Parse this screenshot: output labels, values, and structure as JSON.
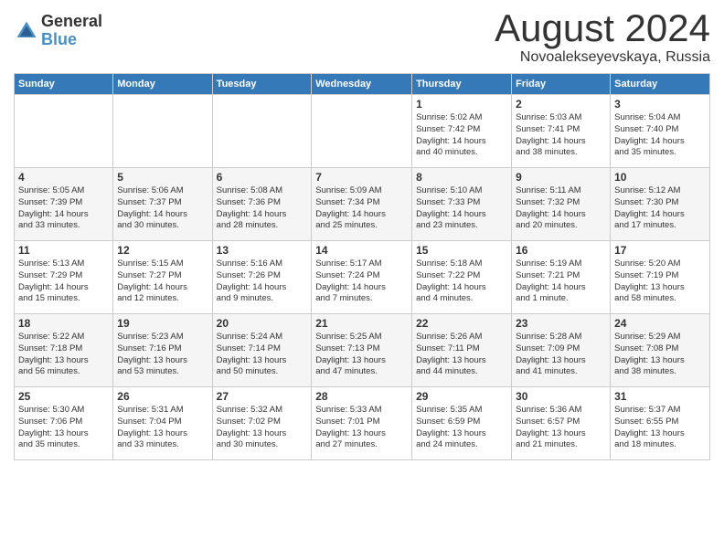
{
  "header": {
    "logo_general": "General",
    "logo_blue": "Blue",
    "month_title": "August 2024",
    "location": "Novoalekseyevskaya, Russia"
  },
  "weekdays": [
    "Sunday",
    "Monday",
    "Tuesday",
    "Wednesday",
    "Thursday",
    "Friday",
    "Saturday"
  ],
  "weeks": [
    [
      {
        "day": "",
        "info": ""
      },
      {
        "day": "",
        "info": ""
      },
      {
        "day": "",
        "info": ""
      },
      {
        "day": "",
        "info": ""
      },
      {
        "day": "1",
        "info": "Sunrise: 5:02 AM\nSunset: 7:42 PM\nDaylight: 14 hours\nand 40 minutes."
      },
      {
        "day": "2",
        "info": "Sunrise: 5:03 AM\nSunset: 7:41 PM\nDaylight: 14 hours\nand 38 minutes."
      },
      {
        "day": "3",
        "info": "Sunrise: 5:04 AM\nSunset: 7:40 PM\nDaylight: 14 hours\nand 35 minutes."
      }
    ],
    [
      {
        "day": "4",
        "info": "Sunrise: 5:05 AM\nSunset: 7:39 PM\nDaylight: 14 hours\nand 33 minutes."
      },
      {
        "day": "5",
        "info": "Sunrise: 5:06 AM\nSunset: 7:37 PM\nDaylight: 14 hours\nand 30 minutes."
      },
      {
        "day": "6",
        "info": "Sunrise: 5:08 AM\nSunset: 7:36 PM\nDaylight: 14 hours\nand 28 minutes."
      },
      {
        "day": "7",
        "info": "Sunrise: 5:09 AM\nSunset: 7:34 PM\nDaylight: 14 hours\nand 25 minutes."
      },
      {
        "day": "8",
        "info": "Sunrise: 5:10 AM\nSunset: 7:33 PM\nDaylight: 14 hours\nand 23 minutes."
      },
      {
        "day": "9",
        "info": "Sunrise: 5:11 AM\nSunset: 7:32 PM\nDaylight: 14 hours\nand 20 minutes."
      },
      {
        "day": "10",
        "info": "Sunrise: 5:12 AM\nSunset: 7:30 PM\nDaylight: 14 hours\nand 17 minutes."
      }
    ],
    [
      {
        "day": "11",
        "info": "Sunrise: 5:13 AM\nSunset: 7:29 PM\nDaylight: 14 hours\nand 15 minutes."
      },
      {
        "day": "12",
        "info": "Sunrise: 5:15 AM\nSunset: 7:27 PM\nDaylight: 14 hours\nand 12 minutes."
      },
      {
        "day": "13",
        "info": "Sunrise: 5:16 AM\nSunset: 7:26 PM\nDaylight: 14 hours\nand 9 minutes."
      },
      {
        "day": "14",
        "info": "Sunrise: 5:17 AM\nSunset: 7:24 PM\nDaylight: 14 hours\nand 7 minutes."
      },
      {
        "day": "15",
        "info": "Sunrise: 5:18 AM\nSunset: 7:22 PM\nDaylight: 14 hours\nand 4 minutes."
      },
      {
        "day": "16",
        "info": "Sunrise: 5:19 AM\nSunset: 7:21 PM\nDaylight: 14 hours\nand 1 minute."
      },
      {
        "day": "17",
        "info": "Sunrise: 5:20 AM\nSunset: 7:19 PM\nDaylight: 13 hours\nand 58 minutes."
      }
    ],
    [
      {
        "day": "18",
        "info": "Sunrise: 5:22 AM\nSunset: 7:18 PM\nDaylight: 13 hours\nand 56 minutes."
      },
      {
        "day": "19",
        "info": "Sunrise: 5:23 AM\nSunset: 7:16 PM\nDaylight: 13 hours\nand 53 minutes."
      },
      {
        "day": "20",
        "info": "Sunrise: 5:24 AM\nSunset: 7:14 PM\nDaylight: 13 hours\nand 50 minutes."
      },
      {
        "day": "21",
        "info": "Sunrise: 5:25 AM\nSunset: 7:13 PM\nDaylight: 13 hours\nand 47 minutes."
      },
      {
        "day": "22",
        "info": "Sunrise: 5:26 AM\nSunset: 7:11 PM\nDaylight: 13 hours\nand 44 minutes."
      },
      {
        "day": "23",
        "info": "Sunrise: 5:28 AM\nSunset: 7:09 PM\nDaylight: 13 hours\nand 41 minutes."
      },
      {
        "day": "24",
        "info": "Sunrise: 5:29 AM\nSunset: 7:08 PM\nDaylight: 13 hours\nand 38 minutes."
      }
    ],
    [
      {
        "day": "25",
        "info": "Sunrise: 5:30 AM\nSunset: 7:06 PM\nDaylight: 13 hours\nand 35 minutes."
      },
      {
        "day": "26",
        "info": "Sunrise: 5:31 AM\nSunset: 7:04 PM\nDaylight: 13 hours\nand 33 minutes."
      },
      {
        "day": "27",
        "info": "Sunrise: 5:32 AM\nSunset: 7:02 PM\nDaylight: 13 hours\nand 30 minutes."
      },
      {
        "day": "28",
        "info": "Sunrise: 5:33 AM\nSunset: 7:01 PM\nDaylight: 13 hours\nand 27 minutes."
      },
      {
        "day": "29",
        "info": "Sunrise: 5:35 AM\nSunset: 6:59 PM\nDaylight: 13 hours\nand 24 minutes."
      },
      {
        "day": "30",
        "info": "Sunrise: 5:36 AM\nSunset: 6:57 PM\nDaylight: 13 hours\nand 21 minutes."
      },
      {
        "day": "31",
        "info": "Sunrise: 5:37 AM\nSunset: 6:55 PM\nDaylight: 13 hours\nand 18 minutes."
      }
    ]
  ]
}
